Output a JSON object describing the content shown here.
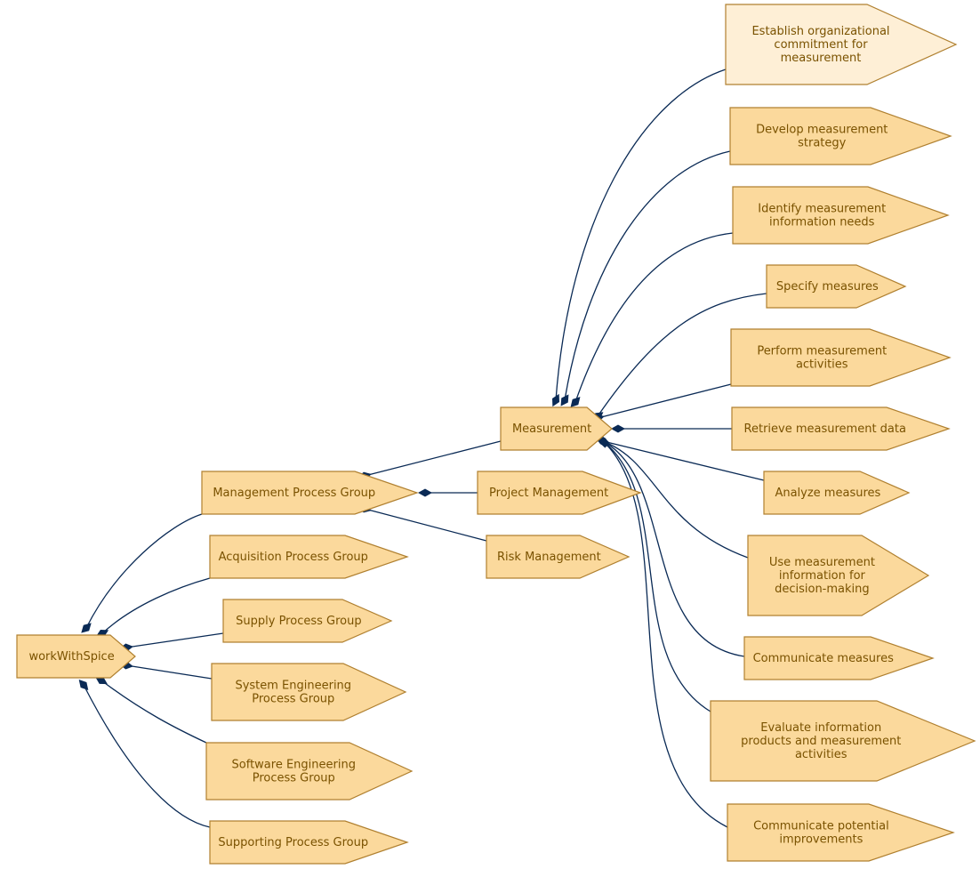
{
  "colors": {
    "node_fill": "#fbd99c",
    "node_fill_highlight": "#feefd6",
    "node_stroke": "#b08030",
    "edge": "#0a2a55",
    "text": "#7a5200"
  },
  "nodes": [
    {
      "id": "root",
      "lines": [
        "workWithSpice"
      ],
      "highlight": false
    },
    {
      "id": "mgmt",
      "lines": [
        "Management Process Group"
      ],
      "highlight": false
    },
    {
      "id": "acq",
      "lines": [
        "Acquisition Process Group"
      ],
      "highlight": false
    },
    {
      "id": "supply",
      "lines": [
        "Supply Process Group"
      ],
      "highlight": false
    },
    {
      "id": "syseng",
      "lines": [
        "System Engineering",
        "Process Group"
      ],
      "highlight": false
    },
    {
      "id": "sweng",
      "lines": [
        "Software Engineering",
        "Process Group"
      ],
      "highlight": false
    },
    {
      "id": "support",
      "lines": [
        "Supporting Process Group"
      ],
      "highlight": false
    },
    {
      "id": "meas",
      "lines": [
        "Measurement"
      ],
      "highlight": false
    },
    {
      "id": "pm",
      "lines": [
        "Project Management"
      ],
      "highlight": false
    },
    {
      "id": "rm",
      "lines": [
        "Risk Management"
      ],
      "highlight": false
    },
    {
      "id": "m1",
      "lines": [
        "Establish organizational",
        "commitment for",
        "measurement"
      ],
      "highlight": true
    },
    {
      "id": "m2",
      "lines": [
        "Develop measurement",
        "strategy"
      ],
      "highlight": false
    },
    {
      "id": "m3",
      "lines": [
        "Identify measurement",
        "information needs"
      ],
      "highlight": false
    },
    {
      "id": "m4",
      "lines": [
        "Specify measures"
      ],
      "highlight": false
    },
    {
      "id": "m5",
      "lines": [
        "Perform measurement",
        "activities"
      ],
      "highlight": false
    },
    {
      "id": "m6",
      "lines": [
        "Retrieve measurement data"
      ],
      "highlight": false
    },
    {
      "id": "m7",
      "lines": [
        "Analyze measures"
      ],
      "highlight": false
    },
    {
      "id": "m8",
      "lines": [
        "Use measurement",
        "information for",
        "decision-making"
      ],
      "highlight": false
    },
    {
      "id": "m9",
      "lines": [
        "Communicate measures"
      ],
      "highlight": false
    },
    {
      "id": "m10",
      "lines": [
        "Evaluate information",
        "products and measurement",
        "activities"
      ],
      "highlight": false
    },
    {
      "id": "m11",
      "lines": [
        "Communicate potential",
        "improvements"
      ],
      "highlight": false
    }
  ],
  "edges": [
    {
      "from": "root",
      "to": "mgmt"
    },
    {
      "from": "root",
      "to": "acq"
    },
    {
      "from": "root",
      "to": "supply"
    },
    {
      "from": "root",
      "to": "syseng"
    },
    {
      "from": "root",
      "to": "sweng"
    },
    {
      "from": "root",
      "to": "support"
    },
    {
      "from": "mgmt",
      "to": "meas"
    },
    {
      "from": "mgmt",
      "to": "pm"
    },
    {
      "from": "mgmt",
      "to": "rm"
    },
    {
      "from": "meas",
      "to": "m1"
    },
    {
      "from": "meas",
      "to": "m2"
    },
    {
      "from": "meas",
      "to": "m3"
    },
    {
      "from": "meas",
      "to": "m4"
    },
    {
      "from": "meas",
      "to": "m5"
    },
    {
      "from": "meas",
      "to": "m6"
    },
    {
      "from": "meas",
      "to": "m7"
    },
    {
      "from": "meas",
      "to": "m8"
    },
    {
      "from": "meas",
      "to": "m9"
    },
    {
      "from": "meas",
      "to": "m10"
    },
    {
      "from": "meas",
      "to": "m11"
    }
  ]
}
